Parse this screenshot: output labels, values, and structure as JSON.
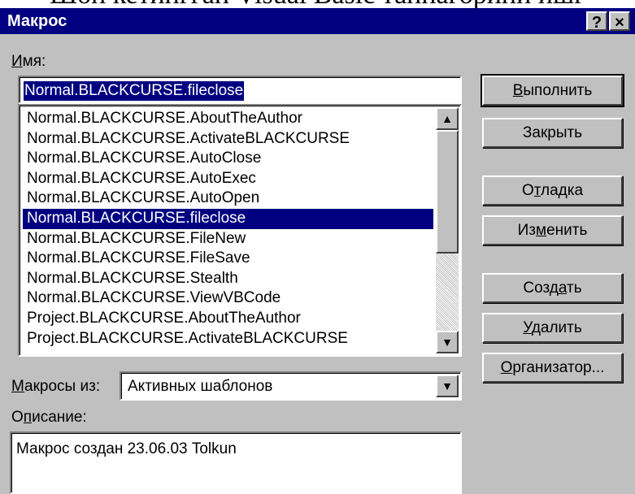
{
  "page_caption": "Шон кетингган Visual Basic таннагорини ишг",
  "dialog": {
    "title": "Макрос",
    "help_label": "?",
    "close_label": "×"
  },
  "name_field": {
    "label": "Имя:",
    "value": "Normal.BLACKCURSE.fileclose"
  },
  "macro_list": {
    "items": [
      "Normal.BLACKCURSE.AboutTheAuthor",
      "Normal.BLACKCURSE.ActivateBLACKCURSE",
      "Normal.BLACKCURSE.AutoClose",
      "Normal.BLACKCURSE.AutoExec",
      "Normal.BLACKCURSE.AutoOpen",
      "Normal.BLACKCURSE.fileclose",
      "Normal.BLACKCURSE.FileNew",
      "Normal.BLACKCURSE.FileSave",
      "Normal.BLACKCURSE.Stealth",
      "Normal.BLACKCURSE.ViewVBCode",
      "Project.BLACKCURSE.AboutTheAuthor",
      "Project.BLACKCURSE.ActivateBLACKCURSE"
    ],
    "selected_index": 5
  },
  "macros_from": {
    "label": "Макросы из:",
    "value": "Активных шаблонов"
  },
  "description": {
    "label": "Описание:",
    "text": "Макрос создан 23.06.03 Tolkun"
  },
  "buttons": {
    "run": "Выполнить",
    "close": "Закрыть",
    "debug": "Отладка",
    "edit": "Изменить",
    "create": "Создать",
    "delete": "Удалить",
    "organizer": "Организатор..."
  },
  "colors": {
    "title_bar": "#000080",
    "selection": "#000080",
    "dialog_face": "#c0c0c0"
  },
  "icons": {
    "scroll_up": "triangle-up-icon",
    "scroll_down": "triangle-down-icon",
    "combo_dropdown": "triangle-down-icon"
  }
}
